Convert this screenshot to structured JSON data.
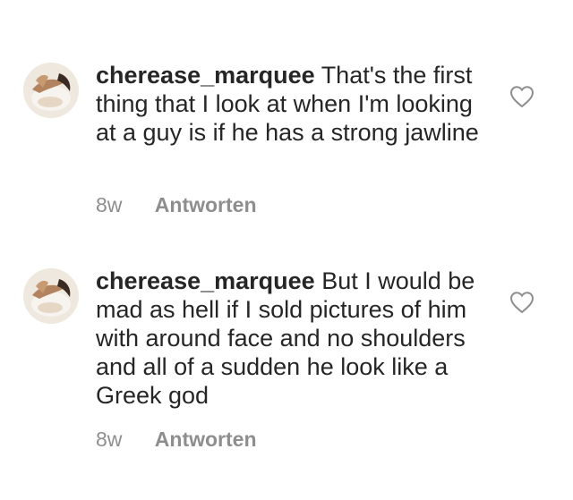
{
  "comments": [
    {
      "username": "cherease_marquee",
      "text": "That's the first thing that I look at when I'm looking at a guy is if he has a strong jawline",
      "time": "8w",
      "reply_label": "Antworten",
      "like_icon": "heart-outline-icon"
    },
    {
      "username": "cherease_marquee",
      "text": "But I would be mad as hell if I sold pictures of him with around face and no shoulders and all of a sudden he look like a Greek god",
      "time": "8w",
      "reply_label": "Antworten",
      "like_icon": "heart-outline-icon"
    }
  ],
  "colors": {
    "text": "#262626",
    "secondary": "#8e8e8e",
    "background": "#ffffff"
  }
}
